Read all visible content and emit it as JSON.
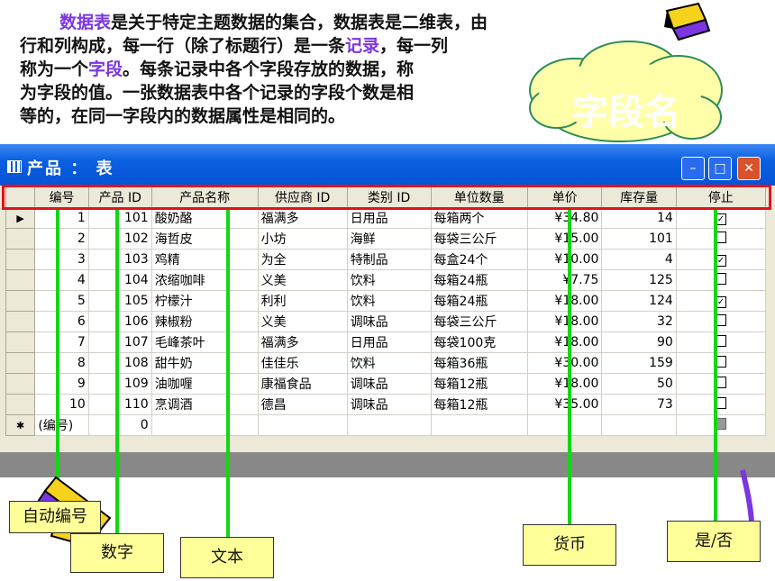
{
  "description": {
    "parts": [
      {
        "t": "数据表",
        "hl": true
      },
      {
        "t": "是关于特定主题数据的集合，数据表是二维表，由",
        "hl": false
      },
      {
        "br": true
      },
      {
        "t": "行和列构成，每一行（除了标题行）是一条",
        "hl": false
      },
      {
        "t": "记录",
        "hl": true
      },
      {
        "t": "，每一列",
        "hl": false
      },
      {
        "br": true
      },
      {
        "t": "称为一个",
        "hl": false
      },
      {
        "t": "字段",
        "hl": true
      },
      {
        "t": "。每条记录中各个字段存放的数据，称",
        "hl": false
      },
      {
        "br": true
      },
      {
        "t": "为字段的值。一张数据表中各个记录的字段个数是相",
        "hl": false
      },
      {
        "br": true
      },
      {
        "t": "等的，在同一字段内的数据属性是相同的。",
        "hl": false
      }
    ]
  },
  "callout": {
    "text": "字段名"
  },
  "window": {
    "title": "产品 ： 表"
  },
  "table": {
    "columns": [
      "编号",
      "产品 ID",
      "产品名称",
      "供应商 ID",
      "类别 ID",
      "单位数量",
      "单价",
      "库存量",
      "停止"
    ],
    "rows": [
      {
        "c": [
          "1",
          "101",
          "酸奶酪",
          "福满多",
          "日用品",
          "每箱两个",
          "¥34.80",
          "14"
        ],
        "stop": true
      },
      {
        "c": [
          "2",
          "102",
          "海哲皮",
          "小坊",
          "海鲜",
          "每袋三公斤",
          "¥15.00",
          "101"
        ],
        "stop": false
      },
      {
        "c": [
          "3",
          "103",
          "鸡精",
          "为全",
          "特制品",
          "每盒24个",
          "¥10.00",
          "4"
        ],
        "stop": true
      },
      {
        "c": [
          "4",
          "104",
          "浓缩咖啡",
          "义美",
          "饮料",
          "每箱24瓶",
          "¥7.75",
          "125"
        ],
        "stop": false
      },
      {
        "c": [
          "5",
          "105",
          "柠檬汁",
          "利利",
          "饮料",
          "每箱24瓶",
          "¥18.00",
          "124"
        ],
        "stop": true
      },
      {
        "c": [
          "6",
          "106",
          "辣椒粉",
          "义美",
          "调味品",
          "每袋三公斤",
          "¥18.00",
          "32"
        ],
        "stop": false
      },
      {
        "c": [
          "7",
          "107",
          "毛峰茶叶",
          "福满多",
          "日用品",
          "每袋100克",
          "¥18.00",
          "90"
        ],
        "stop": false
      },
      {
        "c": [
          "8",
          "108",
          "甜牛奶",
          "佳佳乐",
          "饮料",
          "每箱36瓶",
          "¥30.00",
          "159"
        ],
        "stop": false
      },
      {
        "c": [
          "9",
          "109",
          "油咖喱",
          "康福食品",
          "调味品",
          "每箱12瓶",
          "¥18.00",
          "50"
        ],
        "stop": false
      },
      {
        "c": [
          "10",
          "110",
          "烹调酒",
          "德昌",
          "调味品",
          "每箱12瓶",
          "¥35.00",
          "73"
        ],
        "stop": false
      }
    ],
    "new_row": {
      "id": "(编号)",
      "product_id": "0"
    }
  },
  "labels": {
    "auto_number": "自动编号",
    "number": "数字",
    "text": "文本",
    "currency": "货币",
    "yes_no": "是/否"
  }
}
